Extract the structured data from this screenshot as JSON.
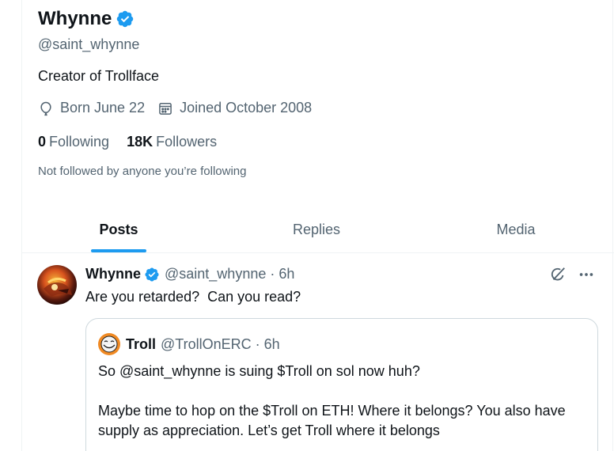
{
  "profile": {
    "name": "Whynne",
    "handle": "@saint_whynne",
    "bio": "Creator of Trollface",
    "born": "Born June 22",
    "joined": "Joined October 2008",
    "following_count": "0",
    "following_label": "Following",
    "followers_count": "18K",
    "followers_label": "Followers",
    "not_followed": "Not followed by anyone you’re following"
  },
  "tabs": [
    {
      "label": "Posts",
      "active": true
    },
    {
      "label": "Replies",
      "active": false
    },
    {
      "label": "Media",
      "active": false
    }
  ],
  "tweet": {
    "name": "Whynne",
    "handle": "@saint_whynne",
    "dot": "·",
    "time": "6h",
    "text": "Are you retarded?  Can you read?",
    "quote": {
      "name": "Troll",
      "handle": "@TrollOnERC",
      "dot": "·",
      "time": "6h",
      "line1": "So @saint_whynne is suing $Troll on sol now huh?",
      "line2": "Maybe time to hop on the $Troll on ETH! Where it belongs? You also have supply as appreciation. Let’s get Troll where it belongs"
    }
  },
  "colors": {
    "accent": "#1d9bf0",
    "secondary_text": "#536471",
    "primary_text": "#0f1419",
    "border": "#eff3f4"
  },
  "icons": {
    "verified": "verified-badge-icon",
    "birthday": "balloon-icon",
    "calendar": "calendar-icon",
    "grok": "grok-icon",
    "more": "more-icon"
  }
}
